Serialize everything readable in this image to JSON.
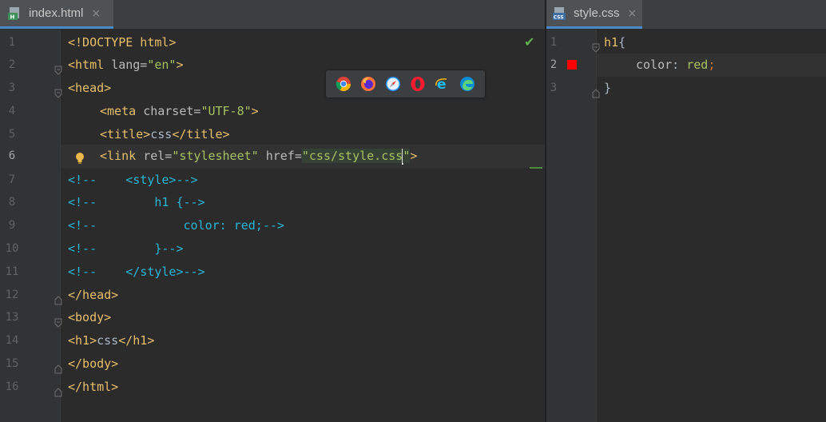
{
  "tabs": {
    "left": {
      "label": "index.html",
      "close": "×"
    },
    "right": {
      "label": "style.css",
      "close": "×"
    }
  },
  "left_editor": {
    "line_numbers": [
      "1",
      "2",
      "3",
      "4",
      "5",
      "6",
      "7",
      "8",
      "9",
      "10",
      "11",
      "12",
      "13",
      "14",
      "15",
      "16"
    ],
    "active_line": "6",
    "lines": {
      "l1": {
        "a": "<!DOCTYPE html>"
      },
      "l2": {
        "a": "<html ",
        "b": "lang=",
        "c": "\"en\"",
        "d": ">"
      },
      "l3": {
        "a": "<head>"
      },
      "l4": {
        "a": "<meta ",
        "b": "charset=",
        "c": "\"UTF-8\"",
        "d": ">"
      },
      "l5": {
        "a": "<title>",
        "b": "css",
        "c": "</title>"
      },
      "l6": {
        "a": "<link ",
        "b": "rel=",
        "c": "\"stylesheet\"",
        "d": " href=",
        "e": "\"",
        "f": "css/style.css",
        "g": "\"",
        "h": ">"
      },
      "l7": {
        "a": "<!--    <style>-->"
      },
      "l8": {
        "a": "<!--        h1 {-->"
      },
      "l9": {
        "a": "<!--            color: red;-->"
      },
      "l10": {
        "a": "<!--        }-->"
      },
      "l11": {
        "a": "<!--    </style>-->"
      },
      "l12": {
        "a": "</head>"
      },
      "l13": {
        "a": "<body>"
      },
      "l14": {
        "a": "<h1>",
        "b": "css",
        "c": "</h1>"
      },
      "l15": {
        "a": "</body>"
      },
      "l16": {
        "a": "</html>"
      }
    }
  },
  "right_editor": {
    "line_numbers": [
      "1",
      "2",
      "3"
    ],
    "active_line": "2",
    "lines": {
      "l1": {
        "a": "h1",
        "b": "{"
      },
      "l2": {
        "a": "color",
        "b": ": ",
        "c": "red",
        "d": ";"
      },
      "l3": {
        "a": "}"
      }
    }
  },
  "browser_icons": [
    "chrome-icon",
    "firefox-icon",
    "safari-icon",
    "opera-icon",
    "ie-icon",
    "edge-icon"
  ],
  "colors": {
    "accent": "#4a88c7",
    "tag": "#e8bf6a",
    "string": "#6a8759",
    "comment": "#29b6d6",
    "keyword": "#cc7832",
    "breakpoint": "#ff0000"
  }
}
